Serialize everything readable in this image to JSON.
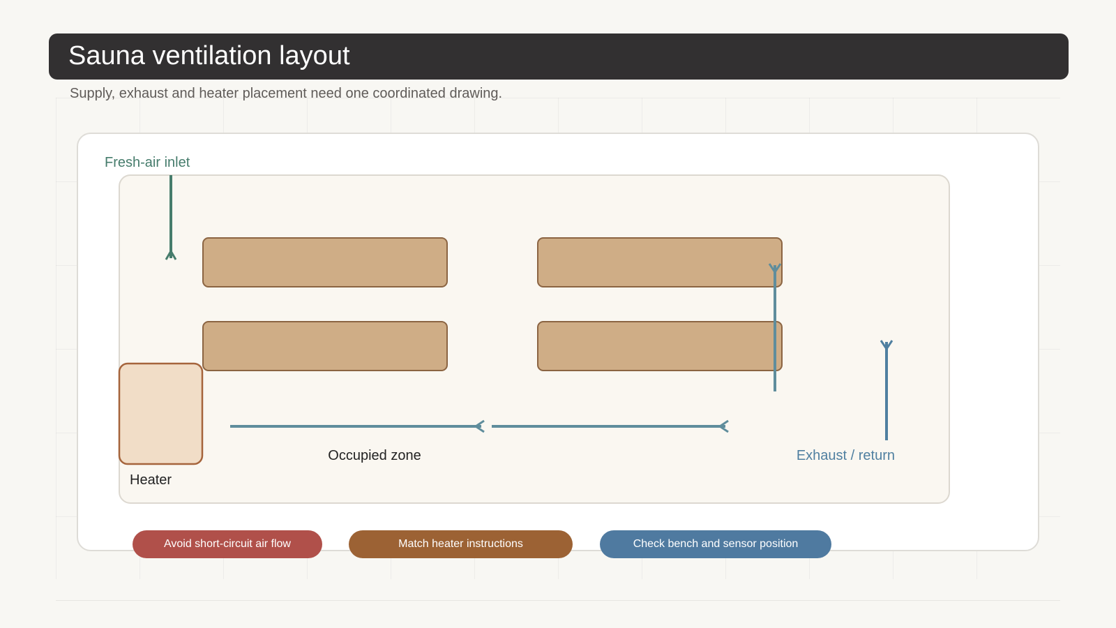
{
  "header": {
    "title": "Sauna ventilation layout",
    "subtitle": "Supply, exhaust and heater placement need one coordinated drawing."
  },
  "diagram": {
    "inlet_label": "Fresh-air inlet",
    "zone_label": "Occupied zone",
    "exhaust_label": "Exhaust / return",
    "heater_label": "Heater",
    "colors": {
      "inlet": "#467c6c",
      "airflow": "#5f8d9c",
      "exhaust": "#4f7fa0",
      "bench_fill": "#cfad86",
      "bench_stroke": "#8b6442",
      "heater_fill": "#f1ddc7",
      "heater_stroke": "#a5643c",
      "room_fill": "#faf7f1"
    }
  },
  "notes": [
    {
      "label": "Avoid short-circuit air flow",
      "color": "#b0504a"
    },
    {
      "label": "Match heater instructions",
      "color": "#9c6234"
    },
    {
      "label": "Check bench and sensor position",
      "color": "#4f7aa0"
    }
  ]
}
